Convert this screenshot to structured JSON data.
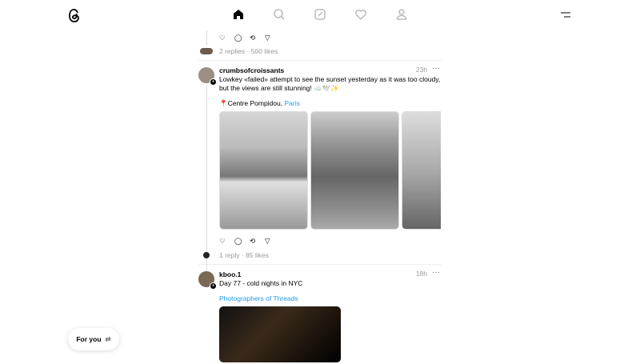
{
  "nav": {
    "items": [
      "home",
      "search",
      "create",
      "activity",
      "profile"
    ]
  },
  "prev_post": {
    "replies": "2 replies",
    "likes": "500 likes"
  },
  "posts": [
    {
      "username": "crumbsofcroissants",
      "time": "23h",
      "text": "Lowkey «failed» attempt to see the sunset yesterday as it was too cloudy, but the views are still stunning! ☁️🕊️✨",
      "location_pin": "📍",
      "location": "Centre Pompidou, ",
      "location_link": "Paris",
      "replies": "1 reply",
      "likes": "85 likes"
    },
    {
      "username": "kboo.1",
      "time": "18h",
      "text": "Day 77 - cold nights in NYC",
      "tag": "Photographers of Threads"
    }
  ],
  "feed_toggle": {
    "label": "For you",
    "icon": "⇄"
  },
  "sep": " · ",
  "more": "···"
}
